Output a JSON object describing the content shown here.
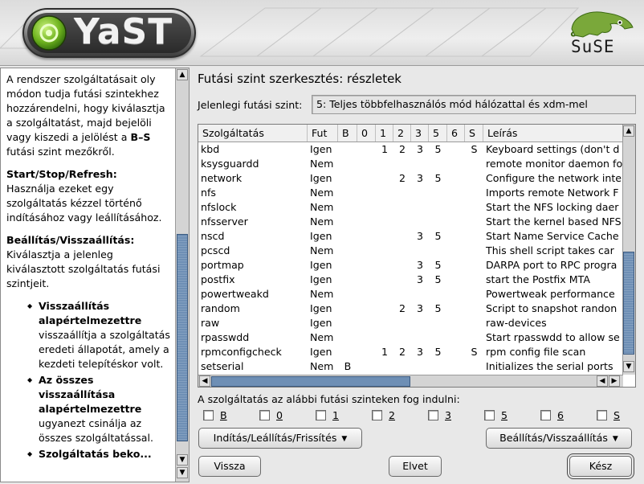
{
  "app": {
    "name": "YaST",
    "vendor": "SuSE"
  },
  "help": {
    "intro": "A rendszer szolgáltatásait oly módon tudja futási szintekhez hozzárendelni, hogy kiválasztja a szolgáltatást, majd bejelöli vagy kiszedi a jelölést a",
    "intro_bold": "B–S",
    "intro_end": "futási szint mezőkről.",
    "h1": "Start/Stop/Refresh:",
    "p1": "Használja ezeket egy szolgáltatás kézzel történő indításához vagy leállításához.",
    "h2": "Beállítás/Visszaállítás:",
    "p2": "Kiválasztja a jelenleg kiválasztott szolgáltatás futási szintjeit.",
    "items": [
      {
        "title": "Visszaállítás alapértelmezettre",
        "text": "visszaállítja a szolgáltatás eredeti állapotát, amely a kezdeti telepítéskor volt."
      },
      {
        "title": "Az összes visszaállítása alapértelmezettre",
        "text": "ugyanezt csinálja az összes szolgáltatással."
      },
      {
        "title": "Szolgáltatás beko...",
        "text": ""
      }
    ]
  },
  "main": {
    "title": "Futási szint szerkesztés: részletek",
    "current_label": "Jelenlegi futási szint:",
    "current_value": "5: Teljes többfelhasználós mód hálózattal és xdm-mel",
    "columns": [
      "Szolgáltatás",
      "Fut",
      "B",
      "0",
      "1",
      "2",
      "3",
      "5",
      "6",
      "S",
      "Leírás"
    ],
    "rows": [
      [
        "kbd",
        "Igen",
        "",
        "",
        "1",
        "2",
        "3",
        "5",
        "",
        "S",
        "Keyboard settings (don't d"
      ],
      [
        "ksysguardd",
        "Nem",
        "",
        "",
        "",
        "",
        "",
        "",
        "",
        "",
        "remote monitor daemon fo"
      ],
      [
        "network",
        "Igen",
        "",
        "",
        "",
        "2",
        "3",
        "5",
        "",
        "",
        "Configure the network inte"
      ],
      [
        "nfs",
        "Nem",
        "",
        "",
        "",
        "",
        "",
        "",
        "",
        "",
        "Imports remote Network F"
      ],
      [
        "nfslock",
        "Nem",
        "",
        "",
        "",
        "",
        "",
        "",
        "",
        "",
        "Start the NFS locking daer"
      ],
      [
        "nfsserver",
        "Nem",
        "",
        "",
        "",
        "",
        "",
        "",
        "",
        "",
        "Start the kernel based NFS"
      ],
      [
        "nscd",
        "Igen",
        "",
        "",
        "",
        "",
        "3",
        "5",
        "",
        "",
        "Start Name Service Cache"
      ],
      [
        "pcscd",
        "Nem",
        "",
        "",
        "",
        "",
        "",
        "",
        "",
        "",
        "This shell script takes car"
      ],
      [
        "portmap",
        "Igen",
        "",
        "",
        "",
        "",
        "3",
        "5",
        "",
        "",
        "DARPA port to RPC progra"
      ],
      [
        "postfix",
        "Igen",
        "",
        "",
        "",
        "",
        "3",
        "5",
        "",
        "",
        "start the Postfix MTA"
      ],
      [
        "powertweakd",
        "Nem",
        "",
        "",
        "",
        "",
        "",
        "",
        "",
        "",
        "Powertweak performance"
      ],
      [
        "random",
        "Igen",
        "",
        "",
        "",
        "2",
        "3",
        "5",
        "",
        "",
        "Script to snapshot randon"
      ],
      [
        "raw",
        "Igen",
        "",
        "",
        "",
        "",
        "",
        "",
        "",
        "",
        "raw-devices"
      ],
      [
        "rpasswdd",
        "Nem",
        "",
        "",
        "",
        "",
        "",
        "",
        "",
        "",
        "Start rpasswdd to allow se"
      ],
      [
        "rpmconfigcheck",
        "Igen",
        "",
        "",
        "1",
        "2",
        "3",
        "5",
        "",
        "S",
        "rpm config file scan"
      ],
      [
        "setserial",
        "Nem",
        "B",
        "",
        "",
        "",
        "",
        "",
        "",
        "",
        "Initializes the serial ports"
      ]
    ],
    "start_label": "A szolgáltatás az alábbi futási szinteken fog indulni:",
    "levels": [
      "B",
      "0",
      "1",
      "2",
      "3",
      "5",
      "6",
      "S"
    ],
    "btn_startstop": "Indítás/Leállítás/Frissítés",
    "btn_setreset": "Beállítás/Visszaállítás",
    "btn_back": "Vissza",
    "btn_abort": "Elvet",
    "btn_finish": "Kész"
  }
}
